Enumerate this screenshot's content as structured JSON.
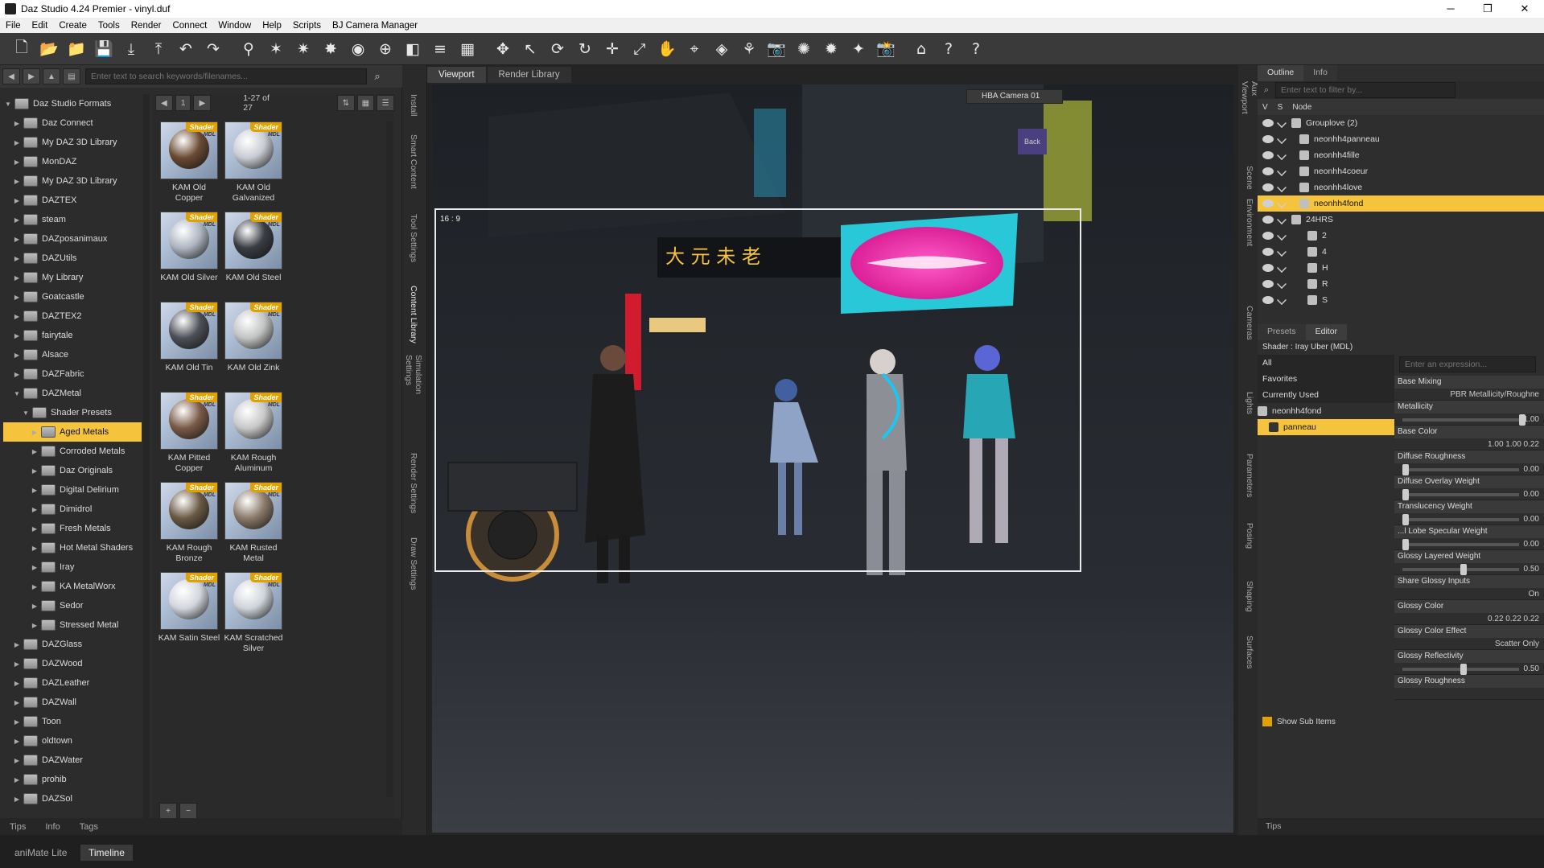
{
  "window": {
    "title": "Daz Studio 4.24 Premier - vinyl.duf",
    "min": "─",
    "max": "❐",
    "close": "✕"
  },
  "menu": [
    "File",
    "Edit",
    "Create",
    "Tools",
    "Render",
    "Connect",
    "Window",
    "Help",
    "Scripts",
    "BJ Camera Manager"
  ],
  "toolbar": {
    "icons": [
      "new-file-icon",
      "open-icon",
      "merge-icon",
      "save-icon",
      "import-icon",
      "export-icon",
      "undo-icon",
      "redo-icon",
      "figure-icon",
      "joint-editor-icon",
      "node-weight-icon",
      "surface-selection-icon",
      "geometry-editor-icon",
      "scene-icon",
      "region-icon",
      "align-icon",
      "grid-icon",
      "universal-icon",
      "node-select-icon",
      "rotate-node-icon",
      "rotate-icon",
      "translate-icon",
      "scale-icon",
      "active-pose-icon",
      "pose-icon",
      "surface-icon",
      "fit-icon",
      "camera-icon",
      "spot-render-icon",
      "iray-icon",
      "light-icon",
      "render-icon",
      "home-icon",
      "whats-this-icon",
      "help-icon"
    ],
    "glyphs": [
      "🗋",
      "📂",
      "📁",
      "💾",
      "⤓",
      "⤒",
      "↶",
      "↷",
      "⚲",
      "✶",
      "✷",
      "✸",
      "◉",
      "⊕",
      "◧",
      "≡",
      "▦",
      "✥",
      "↖",
      "⟳",
      "↻",
      "✛",
      "⤢",
      "✋",
      "⌖",
      "◈",
      "⚘",
      "📷",
      "✺",
      "✹",
      "✦",
      "📸",
      "⌂",
      "?",
      "?"
    ]
  },
  "left_panel": {
    "search_placeholder": "Enter text to search keywords/filenames...",
    "page": "1",
    "range": "1-27 of 27",
    "tree": [
      {
        "label": "Daz Studio Formats",
        "level": 0,
        "open": true
      },
      {
        "label": "Daz Connect",
        "level": 1
      },
      {
        "label": "My DAZ 3D Library",
        "level": 1
      },
      {
        "label": "MonDAZ",
        "level": 1
      },
      {
        "label": "My DAZ 3D Library",
        "level": 1
      },
      {
        "label": "DAZTEX",
        "level": 1
      },
      {
        "label": "steam",
        "level": 1
      },
      {
        "label": "DAZposanimaux",
        "level": 1
      },
      {
        "label": "DAZUtils",
        "level": 1
      },
      {
        "label": "My Library",
        "level": 1
      },
      {
        "label": "Goatcastle",
        "level": 1
      },
      {
        "label": "DAZTEX2",
        "level": 1
      },
      {
        "label": "fairytale",
        "level": 1
      },
      {
        "label": "Alsace",
        "level": 1
      },
      {
        "label": "DAZFabric",
        "level": 1
      },
      {
        "label": "DAZMetal",
        "level": 1,
        "open": true
      },
      {
        "label": "Shader Presets",
        "level": 2,
        "open": true
      },
      {
        "label": "Aged Metals",
        "level": 3,
        "selected": true
      },
      {
        "label": "Corroded Metals",
        "level": 3
      },
      {
        "label": "Daz Originals",
        "level": 3
      },
      {
        "label": "Digital Delirium",
        "level": 3
      },
      {
        "label": "Dimidrol",
        "level": 3
      },
      {
        "label": "Fresh Metals",
        "level": 3
      },
      {
        "label": "Hot Metal Shaders",
        "level": 3
      },
      {
        "label": "Iray",
        "level": 3
      },
      {
        "label": "KA MetalWorx",
        "level": 3
      },
      {
        "label": "Sedor",
        "level": 3
      },
      {
        "label": "Stressed Metal",
        "level": 3
      },
      {
        "label": "DAZGlass",
        "level": 1
      },
      {
        "label": "DAZWood",
        "level": 1
      },
      {
        "label": "DAZLeather",
        "level": 1
      },
      {
        "label": "DAZWall",
        "level": 1
      },
      {
        "label": "Toon",
        "level": 1
      },
      {
        "label": "oldtown",
        "level": 1
      },
      {
        "label": "DAZWater",
        "level": 1
      },
      {
        "label": "prohib",
        "level": 1
      },
      {
        "label": "DAZSol",
        "level": 1
      }
    ],
    "badge": "Shader",
    "badge_sub": "MDL",
    "items": [
      {
        "label": "KAM Old Copper",
        "ball": "#6b4a33"
      },
      {
        "label": "KAM Old Galvanized",
        "ball": "#c8ccd2"
      },
      {
        "label": "KAM Old Silver",
        "ball": "#aeb6c2"
      },
      {
        "label": "KAM Old Steel",
        "ball": "#3a3d42"
      },
      {
        "label": "KAM Old Tin",
        "ball": "#4d5057"
      },
      {
        "label": "KAM Old Zink",
        "ball": "#c2c3c3"
      },
      {
        "label": "KAM Pitted Copper",
        "ball": "#7a5a48"
      },
      {
        "label": "KAM Rough Aluminum",
        "ball": "#c8c8c8"
      },
      {
        "label": "KAM Rough Bronze",
        "ball": "#6a5a45"
      },
      {
        "label": "KAM Rusted Metal",
        "ball": "#8a7a6a"
      },
      {
        "label": "KAM Satin Steel",
        "ball": "#d2d6dc"
      },
      {
        "label": "KAM Scratched Silver",
        "ball": "#cfd4da"
      }
    ],
    "bottom_tabs": [
      "Tips",
      "Info",
      "Tags"
    ]
  },
  "left_vtabs": [
    "Install",
    "Smart Content",
    "Tool Settings",
    "Content Library",
    "Simulation Settings",
    "Render Settings",
    "Draw Settings"
  ],
  "viewport": {
    "tabs": [
      "Viewport",
      "Render Library"
    ],
    "camera": "HBA Camera 01",
    "aspect": "16 : 9",
    "cube_label": "Back"
  },
  "right_vtabs_top": [
    "Aux Viewport",
    "Scene",
    "Environment"
  ],
  "right_vtabs_bottom": [
    "Cameras",
    "Lights",
    "Parameters",
    "Posing",
    "Shaping",
    "Surfaces"
  ],
  "outline": {
    "tabs": [
      "Outline",
      "Info"
    ],
    "filter_placeholder": "Enter text to filter by...",
    "columns": [
      "V",
      "S",
      "Node"
    ],
    "rows": [
      {
        "label": "Grouplove (2)",
        "indent": 0,
        "group": true
      },
      {
        "label": "neonhh4panneau",
        "indent": 1
      },
      {
        "label": "neonhh4fille",
        "indent": 1
      },
      {
        "label": "neonhh4coeur",
        "indent": 1
      },
      {
        "label": "neonhh4love",
        "indent": 1
      },
      {
        "label": "neonhh4fond",
        "indent": 1,
        "selected": true
      },
      {
        "label": "24HRS",
        "indent": 0,
        "group": true
      },
      {
        "label": "2",
        "indent": 2
      },
      {
        "label": "4",
        "indent": 2
      },
      {
        "label": "H",
        "indent": 2
      },
      {
        "label": "R",
        "indent": 2
      },
      {
        "label": "S",
        "indent": 2
      }
    ]
  },
  "editor": {
    "tabs": [
      "Presets",
      "Editor"
    ],
    "shader": "Shader : Iray Uber (MDL)",
    "filter_placeholder": "Enter an expression...",
    "categories": [
      "All",
      "Favorites",
      "Currently Used"
    ],
    "node": "neonhh4fond",
    "surface": "panneau",
    "show_sub": "Show Sub Items",
    "props": [
      {
        "label": "Base Mixing",
        "value": "PBR Metallicity/Roughne"
      },
      {
        "label": "Metallicity",
        "value": "1.00"
      },
      {
        "label": "Base Color",
        "value": "1.00 1.00 0.22"
      },
      {
        "label": "Diffuse Roughness",
        "value": "0.00"
      },
      {
        "label": "Diffuse Overlay Weight",
        "value": "0.00"
      },
      {
        "label": "Translucency Weight",
        "value": "0.00"
      },
      {
        "label": "...l Lobe Specular Weight",
        "value": "0.00"
      },
      {
        "label": "Glossy Layered Weight",
        "value": "0.50"
      },
      {
        "label": "Share Glossy Inputs",
        "value": "On"
      },
      {
        "label": "Glossy Color",
        "value": "0.22 0.22 0.22"
      },
      {
        "label": "Glossy Color Effect",
        "value": "Scatter Only"
      },
      {
        "label": "Glossy Reflectivity",
        "value": "0.50"
      },
      {
        "label": "Glossy Roughness",
        "value": ""
      }
    ],
    "bottom_tab": "Tips"
  },
  "bottom": {
    "tabs": [
      "aniMate Lite",
      "Timeline"
    ]
  },
  "colors": {
    "selection": "#f5c43c",
    "accent": "#e2a100"
  }
}
